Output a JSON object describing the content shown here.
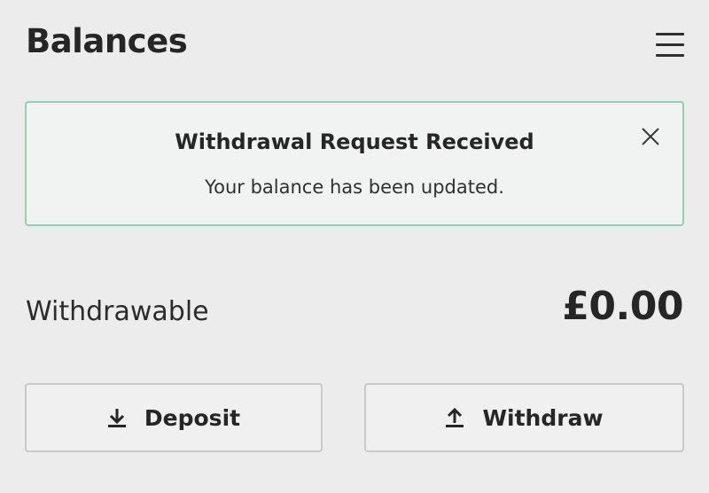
{
  "header": {
    "title": "Balances",
    "menu_icon": "hamburger-menu-icon"
  },
  "notification": {
    "title": "Withdrawal Request Received",
    "message": "Your balance has been updated.",
    "border_color": "#8fd1b3",
    "close_icon": "close-icon"
  },
  "balance": {
    "label": "Withdrawable",
    "amount": "£0.00"
  },
  "actions": {
    "deposit_label": "Deposit",
    "deposit_icon": "download-icon",
    "withdraw_label": "Withdraw",
    "withdraw_icon": "upload-icon"
  }
}
